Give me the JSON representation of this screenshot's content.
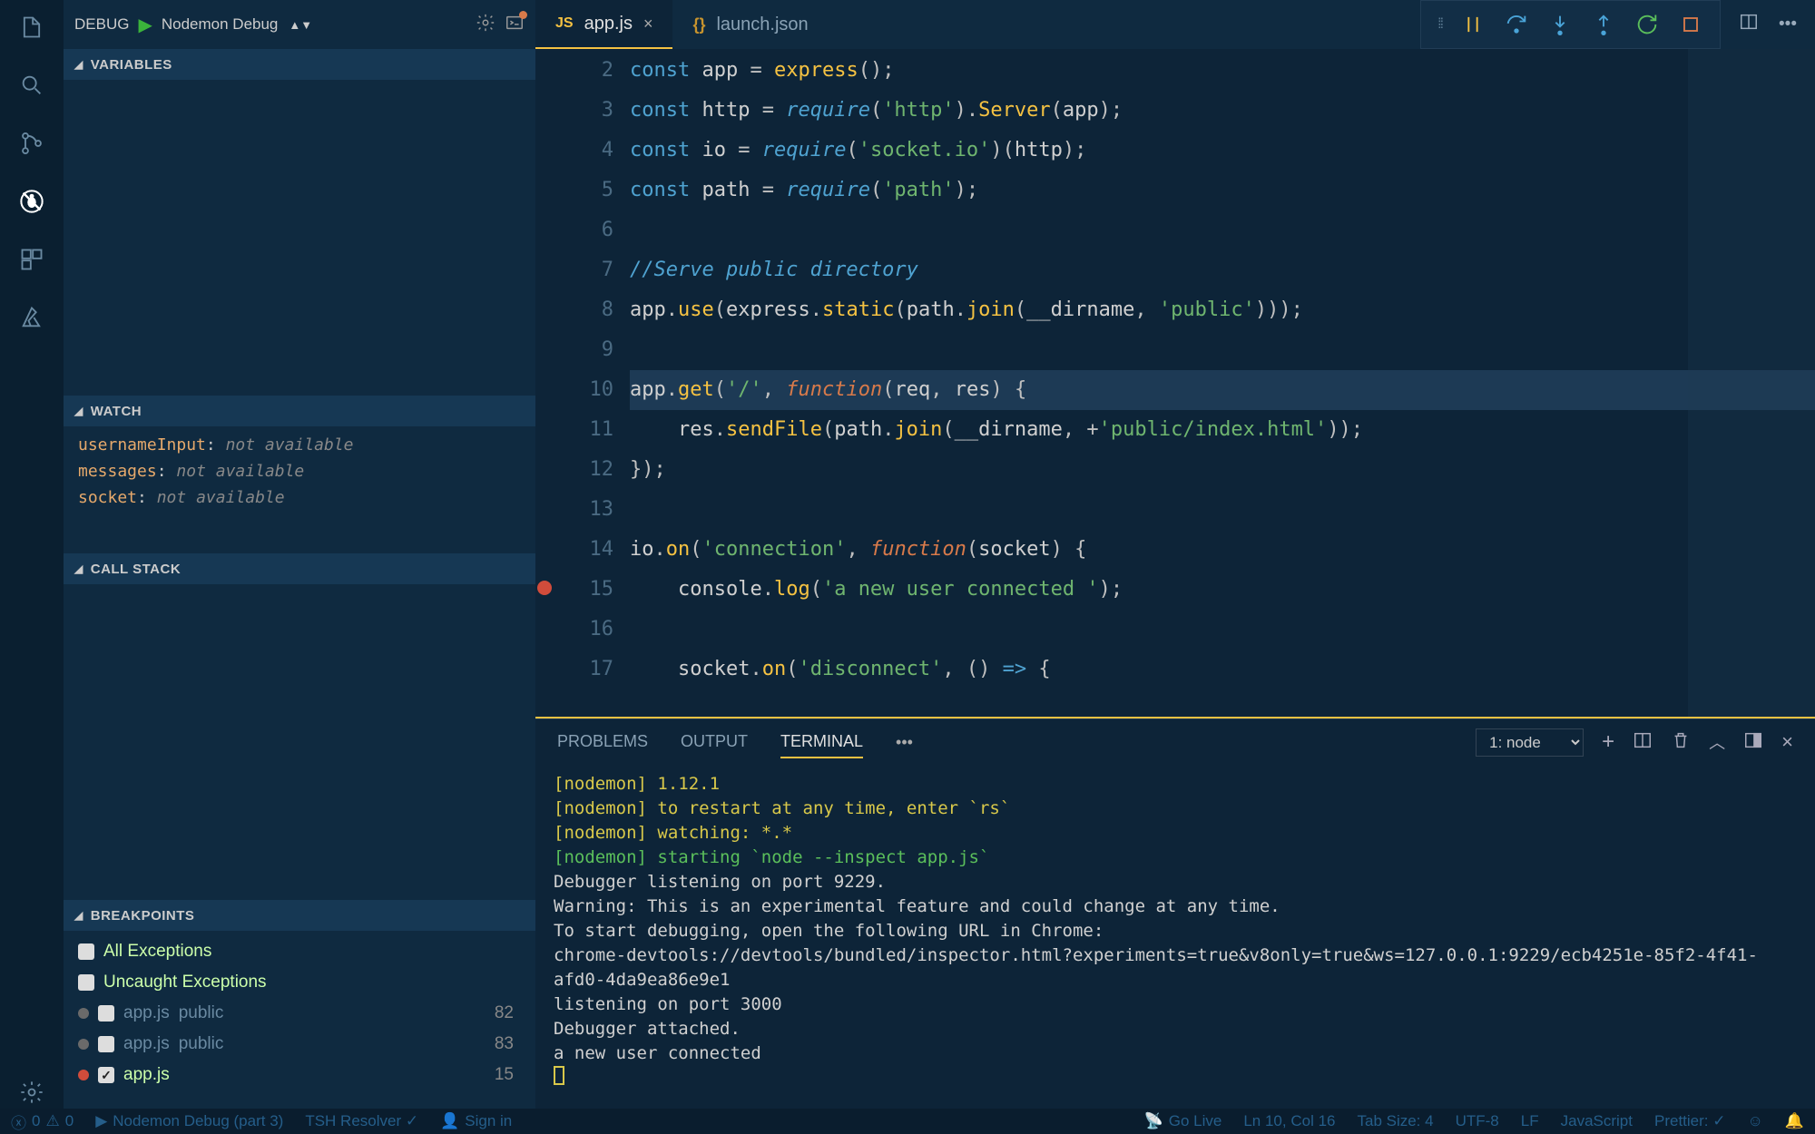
{
  "debug_header": {
    "label": "DEBUG",
    "config": "Nodemon Debug"
  },
  "sections": {
    "variables": "VARIABLES",
    "watch": "WATCH",
    "callstack": "CALL STACK",
    "breakpoints": "BREAKPOINTS"
  },
  "watch": [
    {
      "var": "usernameInput",
      "val": "not available"
    },
    {
      "var": "messages",
      "val": "not available"
    },
    {
      "var": "socket",
      "val": "not available"
    }
  ],
  "breakpoints": {
    "allex": "All Exceptions",
    "uncaught": "Uncaught Exceptions",
    "rows": [
      {
        "file": "app.js",
        "folder": "public",
        "line": "82",
        "active": false,
        "checked": false
      },
      {
        "file": "app.js",
        "folder": "public",
        "line": "83",
        "active": false,
        "checked": false
      },
      {
        "file": "app.js",
        "folder": "",
        "line": "15",
        "active": true,
        "checked": true
      }
    ]
  },
  "tabs": {
    "active": {
      "icon": "JS",
      "name": "app.js"
    },
    "other": {
      "icon": "{}",
      "name": "launch.json"
    }
  },
  "gutter_start": 2,
  "gutter_end": 17,
  "code_lines": [
    {
      "n": 2,
      "html": "<span class='kw'>const</span> <span class='id'>app</span> <span class='punc'>=</span> <span class='fn'>express</span><span class='punc'>();</span>"
    },
    {
      "n": 3,
      "html": "<span class='kw'>const</span> <span class='id'>http</span> <span class='punc'>=</span> <span class='req'>require</span><span class='punc'>(</span><span class='str'>'http'</span><span class='punc'>).</span><span class='fn'>Server</span><span class='punc'>(</span><span class='id'>app</span><span class='punc'>);</span>"
    },
    {
      "n": 4,
      "html": "<span class='kw'>const</span> <span class='id'>io</span> <span class='punc'>=</span> <span class='req'>require</span><span class='punc'>(</span><span class='str'>'socket.io'</span><span class='punc'>)(</span><span class='id'>http</span><span class='punc'>);</span>"
    },
    {
      "n": 5,
      "html": "<span class='kw'>const</span> <span class='id'>path</span> <span class='punc'>=</span> <span class='req'>require</span><span class='punc'>(</span><span class='str'>'path'</span><span class='punc'>);</span>"
    },
    {
      "n": 6,
      "html": ""
    },
    {
      "n": 7,
      "html": "<span class='cmt'>//Serve public directory</span>"
    },
    {
      "n": 8,
      "html": "<span class='id'>app</span><span class='punc'>.</span><span class='fn'>use</span><span class='punc'>(</span><span class='id'>express</span><span class='punc'>.</span><span class='fn'>static</span><span class='punc'>(</span><span class='id'>path</span><span class='punc'>.</span><span class='fn'>join</span><span class='punc'>(</span><span class='id'>__dirname</span><span class='punc'>, </span><span class='str'>'public'</span><span class='punc'>)));</span>"
    },
    {
      "n": 9,
      "html": ""
    },
    {
      "n": 10,
      "hl": true,
      "html": "<span class='id'>app</span><span class='punc'>.</span><span class='fn'>get</span><span class='punc'>(</span><span class='str'>'/'</span><span class='punc'>, </span><span class='kw2'>function</span><span class='punc'>(</span><span class='id'>req</span><span class='punc'>, </span><span class='id'>res</span><span class='punc'>) {</span>"
    },
    {
      "n": 11,
      "html": "    <span class='id'>res</span><span class='punc'>.</span><span class='fn'>sendFile</span><span class='punc'>(</span><span class='id'>path</span><span class='punc'>.</span><span class='fn'>join</span><span class='punc'>(</span><span class='id'>__dirname</span><span class='punc'>, +</span><span class='str'>'public/index.html'</span><span class='punc'>));</span>"
    },
    {
      "n": 12,
      "html": "<span class='punc'>});</span>"
    },
    {
      "n": 13,
      "html": ""
    },
    {
      "n": 14,
      "html": "<span class='id'>io</span><span class='punc'>.</span><span class='fn'>on</span><span class='punc'>(</span><span class='str'>'connection'</span><span class='punc'>, </span><span class='kw2'>function</span><span class='punc'>(</span><span class='id'>socket</span><span class='punc'>) {</span>"
    },
    {
      "n": 15,
      "bp": true,
      "html": "    <span class='id'>console</span><span class='punc'>.</span><span class='fn'>log</span><span class='punc'>(</span><span class='str'>'a new user connected '</span><span class='punc'>);</span>"
    },
    {
      "n": 16,
      "html": ""
    },
    {
      "n": 17,
      "html": "    <span class='id'>socket</span><span class='punc'>.</span><span class='fn'>on</span><span class='punc'>(</span><span class='str'>'disconnect'</span><span class='punc'>, () </span><span class='kw'>=&gt;</span><span class='punc'> {</span>"
    }
  ],
  "panel_tabs": {
    "problems": "PROBLEMS",
    "output": "OUTPUT",
    "terminal": "TERMINAL"
  },
  "terminal_selector": "1: node",
  "terminal_lines": [
    {
      "cls": "ye",
      "text": "[nodemon] 1.12.1"
    },
    {
      "cls": "ye",
      "text": "[nodemon] to restart at any time, enter `rs`"
    },
    {
      "cls": "ye",
      "text": "[nodemon] watching: *.*"
    },
    {
      "cls": "gr",
      "text": "[nodemon] starting `node --inspect app.js`"
    },
    {
      "cls": "wh",
      "text": "Debugger listening on port 9229."
    },
    {
      "cls": "wh",
      "text": "Warning: This is an experimental feature and could change at any time."
    },
    {
      "cls": "wh",
      "text": "To start debugging, open the following URL in Chrome:"
    },
    {
      "cls": "wh",
      "text": "    chrome-devtools://devtools/bundled/inspector.html?experiments=true&v8only=true&ws=127.0.0.1:9229/ecb4251e-85f2-4f41-afd0-4da9ea86e9e1"
    },
    {
      "cls": "wh",
      "text": "listening on port 3000"
    },
    {
      "cls": "wh",
      "text": "Debugger attached."
    },
    {
      "cls": "wh",
      "text": "a new user connected"
    }
  ],
  "status": {
    "errors": "0",
    "warnings": "0",
    "debug": "Nodemon Debug (part 3)",
    "resolver": "TSH Resolver ✓",
    "signin": "Sign in",
    "golive": "Go Live",
    "pos": "Ln 10, Col 16",
    "tabsize": "Tab Size: 4",
    "encoding": "UTF-8",
    "eol": "LF",
    "lang": "JavaScript",
    "prettier": "Prettier: ✓"
  }
}
